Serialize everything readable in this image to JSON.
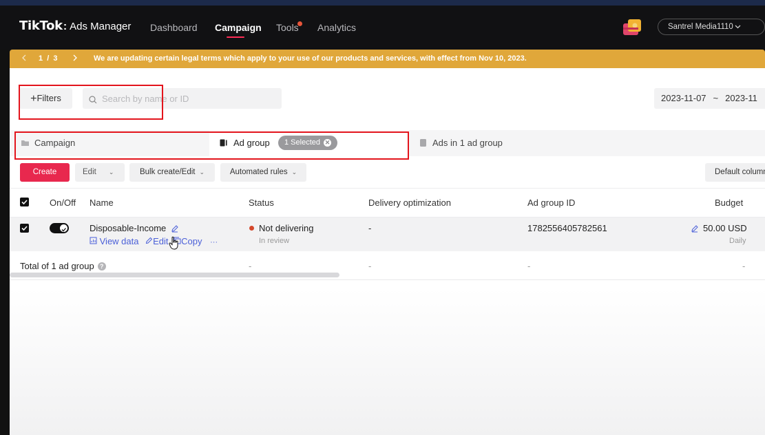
{
  "nav": {
    "brand": "TikTok",
    "colon": ":",
    "product": "Ads Manager",
    "items": [
      {
        "label": "Dashboard"
      },
      {
        "label": "Campaign"
      },
      {
        "label": "Tools"
      },
      {
        "label": "Analytics"
      }
    ],
    "account": "Santrel Media1110"
  },
  "banner": {
    "pager": "1  /  3",
    "message": "We are updating certain legal terms which apply to your use of our products and services, with effect from Nov 10, 2023."
  },
  "toolbar": {
    "filters_label": "Filters",
    "search_placeholder": "Search by name or ID",
    "date_start": "2023-11-07",
    "date_sep": "~",
    "date_end": "2023-11"
  },
  "tabs": {
    "campaign": "Campaign",
    "ad_group": "Ad group",
    "selected_chip": "1 Selected",
    "ads": "Ads in 1 ad group"
  },
  "actions": {
    "create": "Create",
    "edit": "Edit",
    "bulk": "Bulk create/Edit",
    "automated": "Automated rules",
    "columns": "Default columns"
  },
  "table": {
    "headers": {
      "onoff": "On/Off",
      "name": "Name",
      "status": "Status",
      "delivery": "Delivery optimization",
      "adgroup_id": "Ad group ID",
      "budget": "Budget"
    },
    "row": {
      "name": "Disposable-Income",
      "view_data": "View data",
      "edit": "Edit",
      "copy": "Copy",
      "more": "···",
      "status": "Not delivering",
      "status_sub": "In review",
      "delivery": "-",
      "adgroup_id": "1782556405782561",
      "budget": "50.00 USD",
      "budget_sub": "Daily"
    },
    "total": {
      "label": "Total of 1 ad group",
      "status": "-",
      "delivery": "-",
      "adgroup_id": "-",
      "budget": "-"
    }
  },
  "colors": {
    "accent": "#fe2c55",
    "banner": "#e0a73a",
    "link": "#4a5fd8",
    "status_dot": "#d4482b",
    "annotation": "#e3141c"
  }
}
